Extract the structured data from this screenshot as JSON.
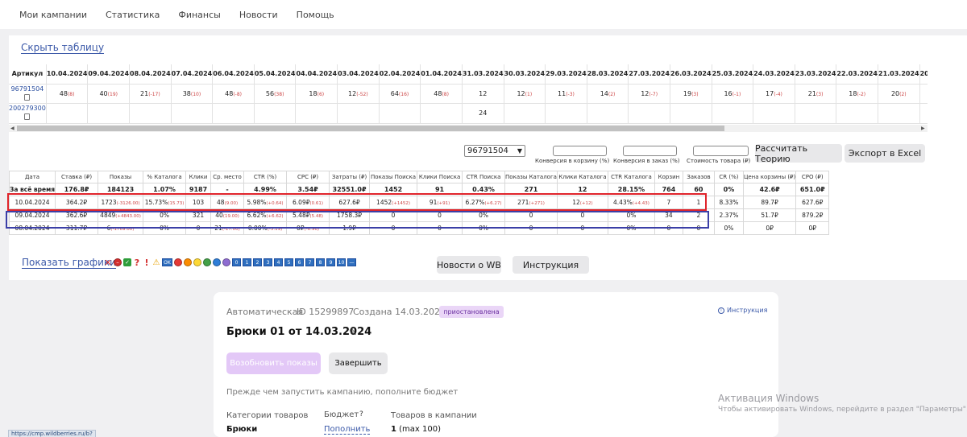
{
  "nav": [
    "Мои кампании",
    "Статистика",
    "Финансы",
    "Новости",
    "Помощь"
  ],
  "hide_table": "Скрыть таблицу",
  "date_grid": {
    "header": [
      "Артикул",
      "10.04.2024",
      "09.04.2024",
      "08.04.2024",
      "07.04.2024",
      "06.04.2024",
      "05.04.2024",
      "04.04.2024",
      "03.04.2024",
      "02.04.2024",
      "01.04.2024",
      "31.03.2024",
      "30.03.2024",
      "29.03.2024",
      "28.03.2024",
      "27.03.2024",
      "26.03.2024",
      "25.03.2024",
      "24.03.2024",
      "23.03.2024",
      "22.03.2024",
      "21.03.2024",
      "20.0"
    ],
    "row1_article": "96791504",
    "row1": [
      [
        "48",
        "(8)"
      ],
      [
        "40",
        "(19)"
      ],
      [
        "21",
        "(-17)"
      ],
      [
        "38",
        "(10)"
      ],
      [
        "48",
        "(-8)"
      ],
      [
        "56",
        "(38)"
      ],
      [
        "18",
        "(6)"
      ],
      [
        "12",
        "(-52)"
      ],
      [
        "64",
        "(16)"
      ],
      [
        "48",
        "(8)"
      ],
      [
        "12",
        ""
      ],
      [
        "12",
        "(1)"
      ],
      [
        "11",
        "(-3)"
      ],
      [
        "14",
        "(2)"
      ],
      [
        "12",
        "(-7)"
      ],
      [
        "19",
        "(3)"
      ],
      [
        "16",
        "(-1)"
      ],
      [
        "17",
        "(-4)"
      ],
      [
        "21",
        "(3)"
      ],
      [
        "18",
        "(-2)"
      ],
      [
        "20",
        "(2)"
      ],
      [
        "",
        ""
      ]
    ],
    "row2_article": "200279300",
    "row2": [
      "",
      "",
      "",
      "",
      "",
      "",
      "",
      "",
      "",
      "",
      "24",
      "",
      "",
      "",
      "",
      "",
      "",
      "",
      "",
      "",
      "",
      ""
    ]
  },
  "filters": {
    "article_select": "96791504",
    "label_conv_cart": "Конверсия в корзину (%)",
    "label_conv_order": "Конверсия в заказ (%)",
    "label_cost": "Стоимость товара (₽)",
    "calc_button": "Рассчитать Теорию",
    "export_button": "Экспорт в Excel"
  },
  "stats": {
    "headers": [
      "Дата",
      "Ставка (₽)",
      "Показы",
      "% Каталога",
      "Клики",
      "Ср. место",
      "CTR (%)",
      "CPC (₽)",
      "Затраты (₽)",
      "Показы Поиска",
      "Клики Поиска",
      "CTR Поиска",
      "Показы Каталога",
      "Клики Каталога",
      "CTR Каталога",
      "Корзин",
      "Заказов",
      "CR (%)",
      "Цена корзины (₽)",
      "CPO (₽)"
    ],
    "total": [
      "За всё время",
      "176.8₽",
      "184123",
      "1.07%",
      "9187",
      "-",
      "4.99%",
      "3.54₽",
      "32551.0₽",
      "1452",
      "91",
      "0.43%",
      "271",
      "12",
      "28.15%",
      "764",
      "60",
      "0%",
      "42.6₽",
      "651.0₽"
    ],
    "rows": [
      [
        [
          "10.04.2024",
          ""
        ],
        [
          "364.2₽",
          ""
        ],
        [
          "1723",
          "(-3126.00)"
        ],
        [
          "15.73%",
          "(15.73)"
        ],
        [
          "103",
          ""
        ],
        [
          "48",
          "(9.00)"
        ],
        [
          "5.98%",
          "(+0.64)"
        ],
        [
          "6.09₽",
          "(0.61)"
        ],
        [
          "627.6₽",
          ""
        ],
        [
          "1452",
          "(+1452)"
        ],
        [
          "91",
          "(+91)"
        ],
        [
          "6.27%",
          "(+6.27)"
        ],
        [
          "271",
          "(+271)"
        ],
        [
          "12",
          "(+12)"
        ],
        [
          "4.43%",
          "(+4.43)"
        ],
        [
          "7",
          ""
        ],
        [
          "1",
          ""
        ],
        [
          "8.33%",
          ""
        ],
        [
          "89.7₽",
          ""
        ],
        [
          "627.6₽",
          ""
        ]
      ],
      [
        [
          "09.04.2024",
          ""
        ],
        [
          "362.6₽",
          ""
        ],
        [
          "4849",
          "(+4843.00)"
        ],
        [
          "0%",
          ""
        ],
        [
          "321",
          ""
        ],
        [
          "40",
          "(19.00)"
        ],
        [
          "6.62%",
          "(+6.62)"
        ],
        [
          "5.48₽",
          "(5.48)"
        ],
        [
          "1758.3₽",
          ""
        ],
        [
          "0",
          ""
        ],
        [
          "0",
          ""
        ],
        [
          "0%",
          ""
        ],
        [
          "0",
          ""
        ],
        [
          "0",
          ""
        ],
        [
          "0%",
          ""
        ],
        [
          "34",
          ""
        ],
        [
          "2",
          ""
        ],
        [
          "2.37%",
          ""
        ],
        [
          "51.7₽",
          ""
        ],
        [
          "879.2₽",
          ""
        ]
      ],
      [
        [
          "08.04.2024",
          ""
        ],
        [
          "311.7₽",
          ""
        ],
        [
          "6",
          "(-1769.00)"
        ],
        [
          "0%",
          ""
        ],
        [
          "0",
          ""
        ],
        [
          "21",
          "(-17.00)"
        ],
        [
          "0.00%",
          "(-5.19)"
        ],
        [
          "0₽",
          "(-6.96)"
        ],
        [
          "1.9₽",
          ""
        ],
        [
          "0",
          ""
        ],
        [
          "0",
          ""
        ],
        [
          "0%",
          ""
        ],
        [
          "0",
          ""
        ],
        [
          "0",
          ""
        ],
        [
          "0%",
          ""
        ],
        [
          "0",
          ""
        ],
        [
          "0",
          ""
        ],
        [
          "0%",
          ""
        ],
        [
          "0₽",
          ""
        ],
        [
          "0₽",
          ""
        ]
      ]
    ]
  },
  "graphs": {
    "show_graphs": "Показать графики",
    "ok_label": "OK",
    "numbers": [
      "0",
      "1",
      "2",
      "3",
      "4",
      "5",
      "6",
      "7",
      "8",
      "9",
      "10"
    ],
    "colors": [
      "#e53935",
      "#fb8c00",
      "#fdd835",
      "#43a047",
      "#2e7dd7",
      "#8e6cd1"
    ],
    "news_button": "Новости о WB",
    "instr_button": "Инструкция"
  },
  "campaign": {
    "type": "Автоматическая",
    "id": "ID 15299897",
    "created": "Создана 14.03.2024",
    "status": "приостановлена",
    "instruction": "Инструкция",
    "title": "Брюки 01 от 14.03.2024",
    "resume_button": "Возобновить показы",
    "finish_button": "Завершить",
    "hint": "Прежде чем запустить кампанию, пополните бюджет",
    "categories_label": "Категории товаров",
    "categories_value": "Брюки",
    "budget_label": "Бюджет",
    "budget_q": "?",
    "budget_link": "Пополнить",
    "products_label": "Товаров в кампании",
    "products_value": "1",
    "products_max": "(max 100)"
  },
  "windows": {
    "line1": "Активация Windows",
    "line2": "Чтобы активировать Windows, перейдите в раздел \"Параметры\"."
  },
  "status_url": "https://cmp.wildberries.ru/b?"
}
